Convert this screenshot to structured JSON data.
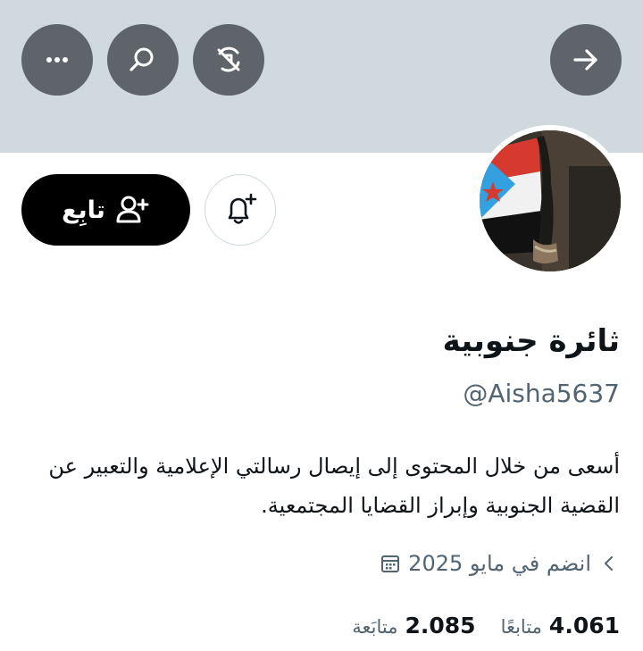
{
  "header": {
    "more_icon": "more-horizontal-icon",
    "search_icon": "search-icon",
    "mute_icon": "muted-circle-icon",
    "forward_icon": "arrow-right-icon",
    "banner_color": "#cfd9de",
    "button_color": "#5e6469"
  },
  "profile": {
    "display_name": "ثائرة جنوبية",
    "handle": "@Aisha5637",
    "bio": "أسعى من خلال المحتوى إلى إيصال رسالتي الإعلامية والتعبير عن القضية الجنوبية وإبراز القضايا المجتمعية.",
    "joined": "انضم في مايو 2025",
    "joined_icon": "calendar-icon",
    "chevron_icon": "chevron-left-icon"
  },
  "actions": {
    "follow_label": "تابِع",
    "follow_icon": "add-person-icon",
    "notify_icon": "bell-plus-icon"
  },
  "stats": {
    "following_count": "2.085",
    "following_label": "متابَعة",
    "followers_count": "4.061",
    "followers_label": "متابعًا"
  }
}
